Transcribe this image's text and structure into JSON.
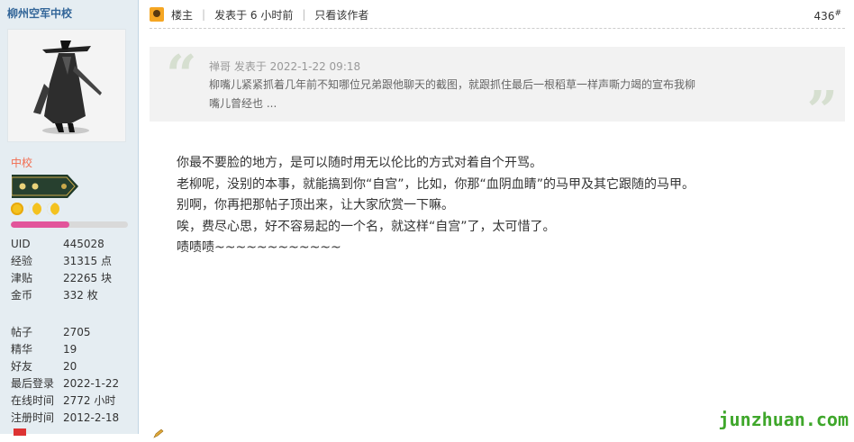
{
  "author": {
    "name": "柳州空军中校",
    "rank_title": "中校",
    "exp_progress": 0.5
  },
  "stats": [
    {
      "label": "UID",
      "value": "445028"
    },
    {
      "label": "经验",
      "value": "31315 点"
    },
    {
      "label": "津贴",
      "value": "22265 块"
    },
    {
      "label": "金币",
      "value": "332 枚"
    }
  ],
  "stats2": [
    {
      "label": "帖子",
      "value": "2705"
    },
    {
      "label": "精华",
      "value": "19"
    },
    {
      "label": "好友",
      "value": "20"
    },
    {
      "label": "最后登录",
      "value": "2022-1-22"
    },
    {
      "label": "在线时间",
      "value": "2772 小时"
    },
    {
      "label": "注册时间",
      "value": "2012-2-18"
    }
  ],
  "post_header": {
    "owner_label": "楼主",
    "posted_at": "发表于 6 小时前",
    "only_author": "只看该作者",
    "floor": "436",
    "floor_mark": "#"
  },
  "quote": {
    "meta": "禅哥 发表于 2022-1-22 09:18",
    "line1": "柳嘴儿紧紧抓着几年前不知哪位兄弟跟他聊天的截图，就跟抓住最后一根稻草一样声嘶力竭的宣布我柳",
    "line2": "嘴儿曾经也 ..."
  },
  "message_lines": [
    "你最不要脸的地方，是可以随时用无以伦比的方式对着自个开骂。",
    "老柳呢，没别的本事，就能搞到你“自宫”，比如，你那“血阴血睛”的马甲及其它跟随的马甲。",
    "别啊，你再把那帖子顶出来，让大家欣赏一下嘛。",
    "唉，费尽心思，好不容易起的一个名，就这样“自宫”了，太可惜了。",
    "啧啧啧~~~~~~~~~~~~"
  ],
  "watermark": "junzhuan.com",
  "colors": {
    "sidebar_bg": "#e5edf2",
    "author_link": "#336699",
    "rank_title": "#f26c4f",
    "exp_bar": "#e2559b",
    "watermark": "#3fa72b"
  },
  "icons": {
    "owner": "owner-badge-icon",
    "medals": [
      "sun-medal-icon",
      "moon-medal-icon",
      "moon-medal-icon"
    ],
    "edit": "pencil-icon"
  }
}
